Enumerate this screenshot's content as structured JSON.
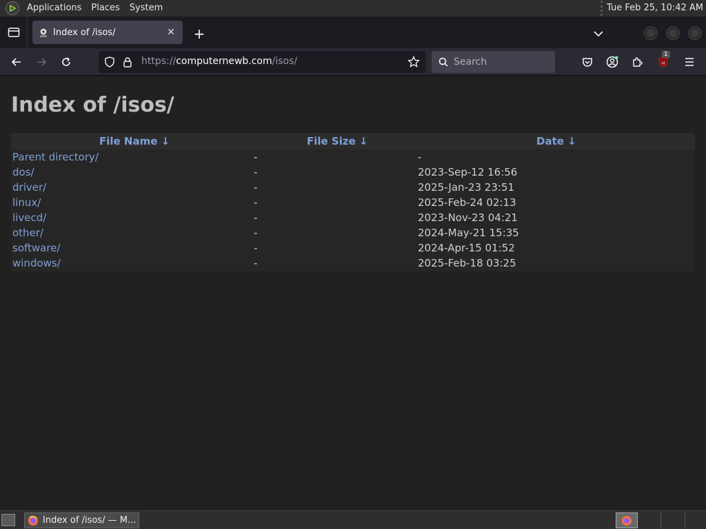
{
  "system_panel": {
    "menus": [
      "Applications",
      "Places",
      "System"
    ],
    "clock": "Tue Feb 25, 10:42 AM"
  },
  "browser": {
    "tab": {
      "title": "Index of /isos/"
    },
    "url": {
      "scheme": "https://",
      "host": "computernewb.com",
      "path": "/isos/"
    },
    "search": {
      "placeholder": "Search"
    },
    "extension_badge": "1"
  },
  "page": {
    "heading": "Index of /isos/",
    "columns": {
      "name": "File Name ↓",
      "size": "File Size ↓",
      "date": "Date ↓"
    },
    "rows": [
      {
        "name": "Parent directory/",
        "size": "-",
        "date": "-"
      },
      {
        "name": "dos/",
        "size": "-",
        "date": "2023-Sep-12 16:56"
      },
      {
        "name": "driver/",
        "size": "-",
        "date": "2025-Jan-23 23:51"
      },
      {
        "name": "linux/",
        "size": "-",
        "date": "2025-Feb-24 02:13"
      },
      {
        "name": "livecd/",
        "size": "-",
        "date": "2023-Nov-23 04:21"
      },
      {
        "name": "other/",
        "size": "-",
        "date": "2024-May-21 15:35"
      },
      {
        "name": "software/",
        "size": "-",
        "date": "2024-Apr-15 01:52"
      },
      {
        "name": "windows/",
        "size": "-",
        "date": "2025-Feb-18 03:25"
      }
    ]
  },
  "taskbar": {
    "task_title": "Index of /isos/ — M..."
  },
  "colors": {
    "link": "#7f9fd6",
    "page_bg": "#212121",
    "heading": "#bdbdbd"
  }
}
